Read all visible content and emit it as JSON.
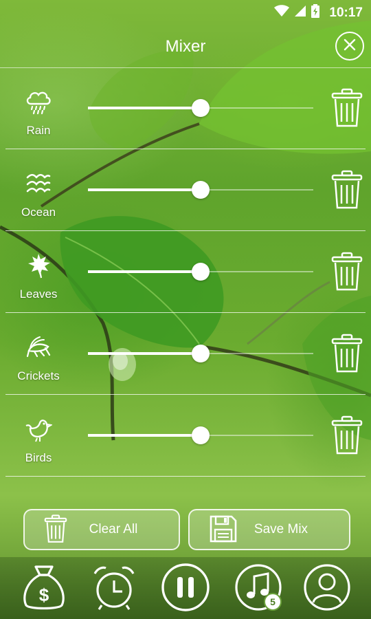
{
  "status_bar": {
    "time": "10:17"
  },
  "header": {
    "title": "Mixer"
  },
  "sounds": [
    {
      "label": "Rain",
      "icon": "rain-cloud-icon",
      "volume": 0.5
    },
    {
      "label": "Ocean",
      "icon": "waves-icon",
      "volume": 0.5
    },
    {
      "label": "Leaves",
      "icon": "leaf-icon",
      "volume": 0.5
    },
    {
      "label": "Crickets",
      "icon": "cricket-icon",
      "volume": 0.5
    },
    {
      "label": "Birds",
      "icon": "bird-icon",
      "volume": 0.5
    }
  ],
  "actions": {
    "clear_all": "Clear All",
    "save_mix": "Save Mix"
  },
  "bottom_nav": {
    "items": [
      "money-bag-icon",
      "alarm-clock-icon",
      "pause-icon",
      "music-note-icon",
      "user-icon"
    ],
    "playlist_badge": "5"
  },
  "colors": {
    "accent": "#ffffff",
    "badge_text": "#4c7d22"
  }
}
